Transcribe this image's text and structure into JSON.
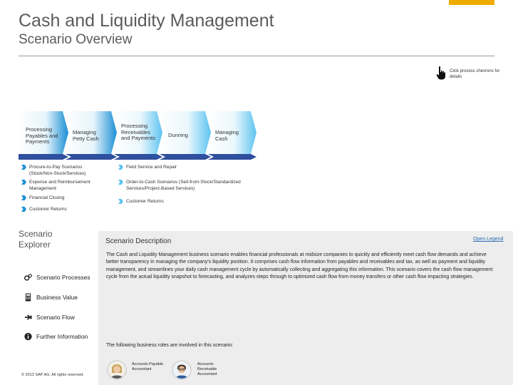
{
  "header": {
    "title": "Cash and Liquidity Management",
    "subtitle": "Scenario Overview",
    "accent_color": "#f0ab00"
  },
  "hint": {
    "text": "Click process chevrons for details",
    "icon": "hand-pointer-icon"
  },
  "process_chevrons": [
    {
      "label": "Processing Payables and Payments"
    },
    {
      "label": "Managing Petty Cash"
    },
    {
      "label": "Processing Receivables and Payments"
    },
    {
      "label": "Dunning"
    },
    {
      "label": "Managing Cash"
    }
  ],
  "process_colors": {
    "dark": "#1a8fd4",
    "light": "#5dc3f0",
    "stripe": "#2f4f9f"
  },
  "process_items_left": [
    "Procure-to-Pay Scenarios (Stock/Non-Stock/Services)",
    "Expense and Reimbursement Management",
    "Financial Closing",
    "Customer Returns"
  ],
  "process_items_right": [
    "Field Service and Repair",
    "Order-to-Cash Scenarios (Sell-from-Stock/Standardized Services/Project-Based Services)",
    "Customer Returns"
  ],
  "explorer": {
    "title": "Scenario Explorer",
    "items": [
      {
        "label": "Scenario Processes",
        "icon": "gears-icon"
      },
      {
        "label": "Business Value",
        "icon": "calculator-icon"
      },
      {
        "label": "Scenario Flow",
        "icon": "flow-icon"
      },
      {
        "label": "Further Information",
        "icon": "info-icon"
      }
    ]
  },
  "description": {
    "title": "Scenario Description",
    "legend_link": "Open Legend",
    "text": "The Cash and Liquidity Management business scenario enables financial professionals at midsize companies to quickly and efficiently meet cash flow demands and achieve better transparency in managing the company's liquidity position. It comprises cash flow information from payables and receivables and tax, as well as payment and liquidity management, and streamlines your daily cash management cycle by automatically collecting and aggregating this information. This scenario covers the cash flow management cycle from the actual liquidity snapshot to forecasting, and analyzes steps through to optimized cash flow from money transfers or other cash flow impacting strategies.",
    "roles_intro": "The following business roles are involved in this scenario:",
    "roles": [
      {
        "label": "Accounts Payable Accountant"
      },
      {
        "label": "Accounts Receivable Accountant"
      }
    ]
  },
  "footer": {
    "copyright": "© 2013 SAP AG. All rights reserved."
  }
}
